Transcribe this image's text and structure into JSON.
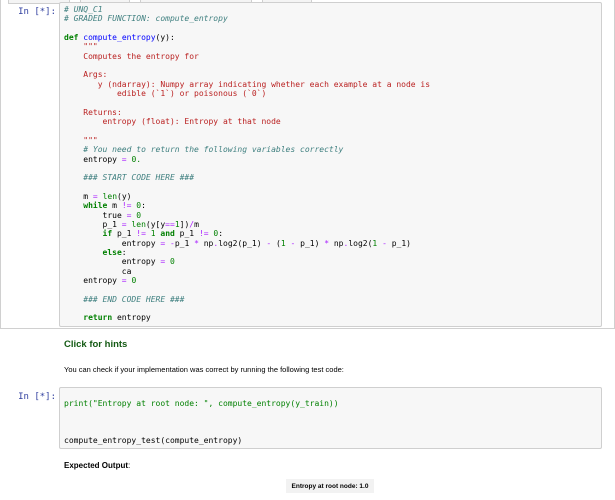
{
  "cell1": {
    "prompt": "In [*]:",
    "code": {
      "l1": "# UNQ_C1",
      "l2": "# GRADED FUNCTION: compute_entropy",
      "l4a": "def",
      "l4b": "compute_entropy",
      "l4c": "(y):",
      "l5": "    \"\"\"",
      "l6": "    Computes the entropy for",
      "l8": "    Args:",
      "l9": "       y (ndarray): Numpy array indicating whether each example at a node is",
      "l10": "           edible (`1`) or poisonous (`0`)",
      "l12": "    Returns:",
      "l13": "        entropy (float): Entropy at that node",
      "l15": "    \"\"\"",
      "l16": "    # You need to return the following variables correctly",
      "l19": "    ### START CODE HERE ###",
      "l30": "    ### END CODE HERE ###"
    }
  },
  "hint_label": "Click for hints",
  "check_text": "You can check if your implementation was correct by running the following test code:",
  "cell2": {
    "prompt": "In [*]:",
    "line1": "print(\"Entropy at root node: \", compute_entropy(y_train))",
    "line2": "compute_entropy_test(compute_entropy)"
  },
  "expected_label": "Expected Output",
  "expected_colon": ":",
  "expected_value": "Entropy at root node: 1.0"
}
